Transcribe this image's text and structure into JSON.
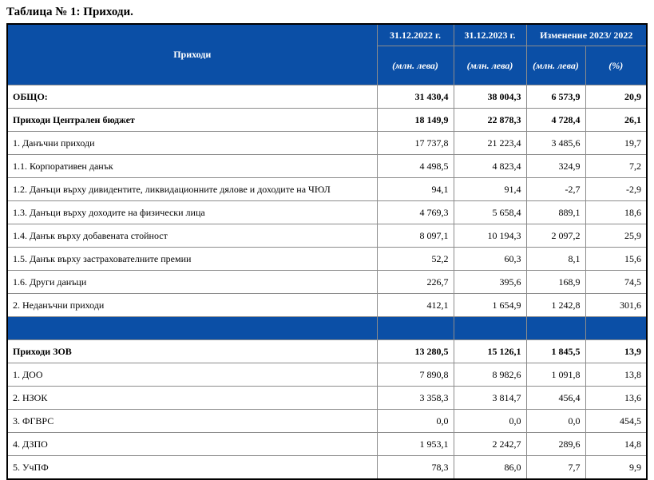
{
  "title": "Таблица № 1: Приходи.",
  "header": {
    "label": "Приходи",
    "col1_date": "31.12.2022 г.",
    "col2_date": "31.12.2023 г.",
    "change": "Изменение 2023/ 2022",
    "unit1": "(млн. лева)",
    "unit2": "(млн. лева)",
    "unit3": "(млн. лева)",
    "unit4": "(%)"
  },
  "rows": [
    {
      "label": "ОБЩО:",
      "v2022": "31 430,4",
      "v2023": "38 004,3",
      "diff": "6 573,9",
      "pct": "20,9"
    },
    {
      "label": "Приходи Централен бюджет",
      "v2022": "18 149,9",
      "v2023": "22 878,3",
      "diff": "4 728,4",
      "pct": "26,1"
    },
    {
      "label": "1. Данъчни приходи",
      "v2022": "17 737,8",
      "v2023": "21 223,4",
      "diff": "3 485,6",
      "pct": "19,7"
    },
    {
      "label": "1.1. Корпоративен данък",
      "v2022": "4 498,5",
      "v2023": "4 823,4",
      "diff": "324,9",
      "pct": "7,2"
    },
    {
      "label": "1.2. Данъци върху дивидентите, ликвидационните дялове и доходите на ЧЮЛ",
      "v2022": "94,1",
      "v2023": "91,4",
      "diff": "-2,7",
      "pct": "-2,9"
    },
    {
      "label": "1.3. Данъци върху доходите на физически лица",
      "v2022": "4 769,3",
      "v2023": "5 658,4",
      "diff": "889,1",
      "pct": "18,6"
    },
    {
      "label": "1.4. Данък върху добавената стойност",
      "v2022": "8 097,1",
      "v2023": "10 194,3",
      "diff": "2 097,2",
      "pct": "25,9"
    },
    {
      "label": "1.5. Данък върху застрахователните премии",
      "v2022": "52,2",
      "v2023": "60,3",
      "diff": "8,1",
      "pct": "15,6"
    },
    {
      "label": "1.6. Други данъци",
      "v2022": "226,7",
      "v2023": "395,6",
      "diff": "168,9",
      "pct": "74,5"
    },
    {
      "label": "2. Неданъчни приходи",
      "v2022": "412,1",
      "v2023": "1 654,9",
      "diff": "1 242,8",
      "pct": "301,6"
    },
    {
      "label": "Приходи ЗОВ",
      "v2022": "13 280,5",
      "v2023": "15 126,1",
      "diff": "1 845,5",
      "pct": "13,9"
    },
    {
      "label": "1. ДОО",
      "v2022": "7 890,8",
      "v2023": "8 982,6",
      "diff": "1 091,8",
      "pct": "13,8"
    },
    {
      "label": "2. НЗОК",
      "v2022": "3 358,3",
      "v2023": "3 814,7",
      "diff": "456,4",
      "pct": "13,6"
    },
    {
      "label": "3. ФГВРС",
      "v2022": "0,0",
      "v2023": "0,0",
      "diff": "0,0",
      "pct": "454,5"
    },
    {
      "label": "4. ДЗПО",
      "v2022": "1 953,1",
      "v2023": "2 242,7",
      "diff": "289,6",
      "pct": "14,8"
    },
    {
      "label": "5. УчПФ",
      "v2022": "78,3",
      "v2023": "86,0",
      "diff": "7,7",
      "pct": "9,9"
    }
  ]
}
